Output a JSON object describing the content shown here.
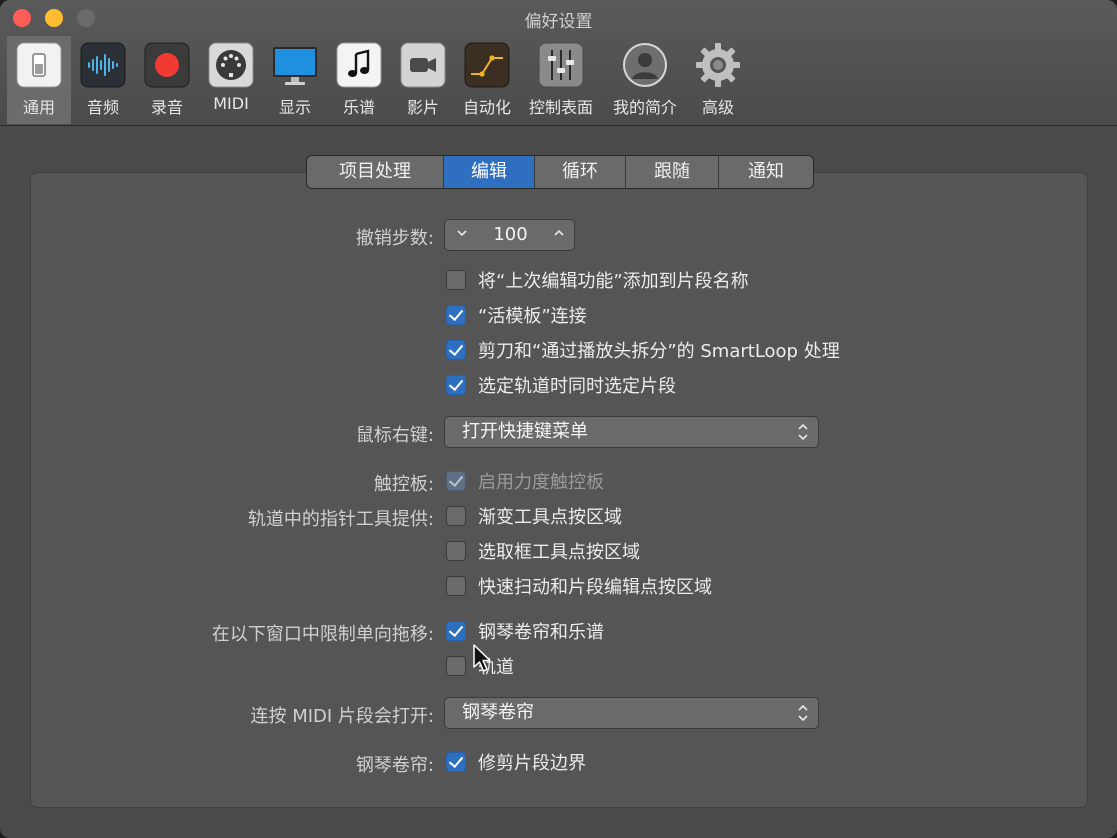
{
  "window": {
    "title": "偏好设置"
  },
  "toolbar": {
    "items": [
      {
        "label": "通用",
        "icon": "general-switch-icon"
      },
      {
        "label": "音频",
        "icon": "audio-waveform-icon"
      },
      {
        "label": "录音",
        "icon": "record-icon"
      },
      {
        "label": "MIDI",
        "icon": "midi-port-icon"
      },
      {
        "label": "显示",
        "icon": "display-monitor-icon"
      },
      {
        "label": "乐谱",
        "icon": "score-note-icon"
      },
      {
        "label": "影片",
        "icon": "movie-camera-icon"
      },
      {
        "label": "自动化",
        "icon": "automation-curve-icon"
      },
      {
        "label": "控制表面",
        "icon": "control-surface-faders-icon"
      },
      {
        "label": "我的简介",
        "icon": "user-profile-icon"
      },
      {
        "label": "高级",
        "icon": "advanced-gear-icon"
      }
    ],
    "active": "通用"
  },
  "tabs": {
    "items": [
      "项目处理",
      "编辑",
      "循环",
      "跟随",
      "通知"
    ],
    "active": "编辑"
  },
  "form": {
    "undo_steps": {
      "label": "撤销步数:",
      "value": "100"
    },
    "edit_options": [
      {
        "label": "将“上次编辑功能”添加到片段名称",
        "checked": false
      },
      {
        "label": "“活模板”连接",
        "checked": true
      },
      {
        "label": "剪刀和“通过播放头拆分”的 SmartLoop 处理",
        "checked": true
      },
      {
        "label": "选定轨道时同时选定片段",
        "checked": true
      }
    ],
    "right_click": {
      "label": "鼠标右键:",
      "value": "打开快捷键菜单"
    },
    "trackpad": {
      "label": "触控板:",
      "option": "启用力度触控板",
      "checked": true,
      "disabled": true
    },
    "pointer_tool": {
      "label": "轨道中的指针工具提供:",
      "options": [
        {
          "label": "渐变工具点按区域",
          "checked": false
        },
        {
          "label": "选取框工具点按区域",
          "checked": false
        },
        {
          "label": "快速扫动和片段编辑点按区域",
          "checked": false
        }
      ]
    },
    "limit_drag": {
      "label": "在以下窗口中限制单向拖移:",
      "options": [
        {
          "label": "钢琴卷帘和乐谱",
          "checked": true
        },
        {
          "label": "轨道",
          "checked": false
        }
      ]
    },
    "midi_double_click": {
      "label": "连按 MIDI 片段会打开:",
      "value": "钢琴卷帘"
    },
    "piano_roll": {
      "label": "钢琴卷帘:",
      "option": "修剪片段边界",
      "checked": true
    }
  },
  "colors": {
    "accent": "#2f6fc0",
    "background": "#4a4a4a",
    "panel": "#555555"
  }
}
